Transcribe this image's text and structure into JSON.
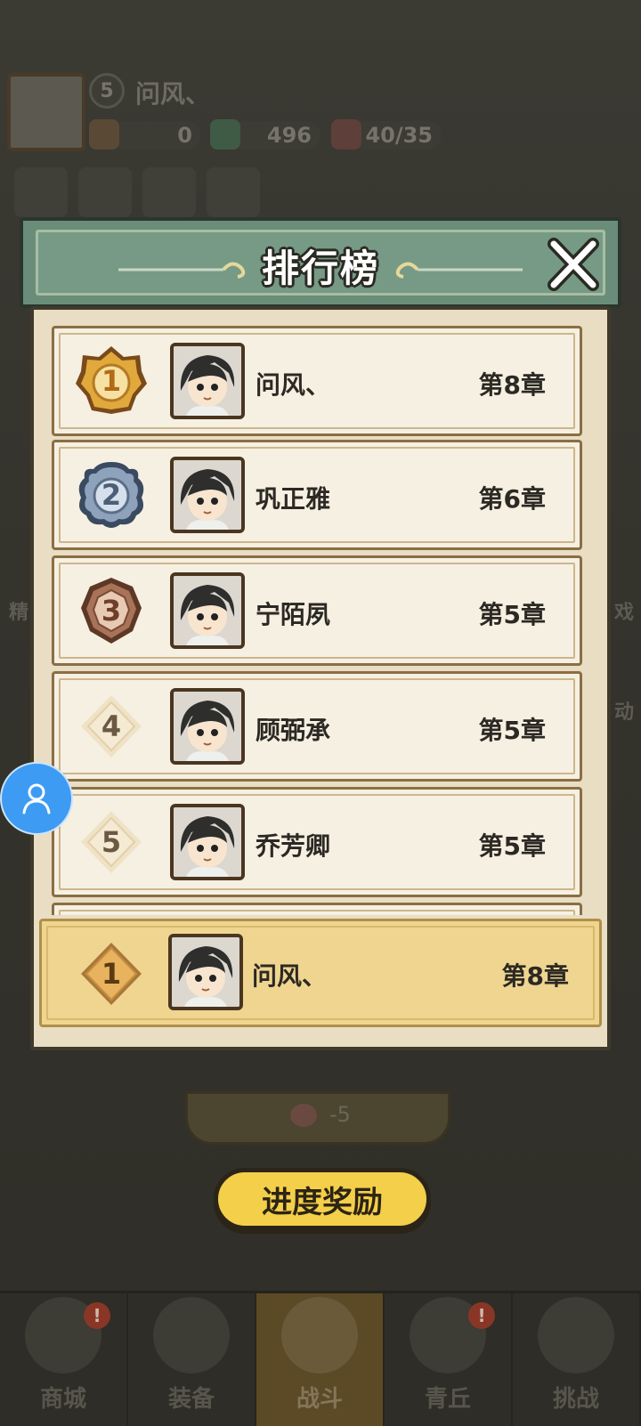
{
  "hud": {
    "level": "5",
    "player_name": "问风、",
    "resources": [
      {
        "icon": "coin-bag-icon",
        "value": "0"
      },
      {
        "icon": "jade-dragon-icon",
        "value": "496"
      },
      {
        "icon": "peach-energy-icon",
        "value": "40/35"
      }
    ]
  },
  "side_labels": {
    "left": "精",
    "right_top": "戏",
    "right_bottom": "动"
  },
  "progress": {
    "cost": "-5"
  },
  "progress_reward_label": "进度奖励",
  "leaderboard": {
    "title": "排行榜",
    "rows": [
      {
        "rank": "1",
        "name": "问风、",
        "chapter": "第8章"
      },
      {
        "rank": "2",
        "name": "巩正雅",
        "chapter": "第6章"
      },
      {
        "rank": "3",
        "name": "宁陌夙",
        "chapter": "第5章"
      },
      {
        "rank": "4",
        "name": "顾弼承",
        "chapter": "第5章"
      },
      {
        "rank": "5",
        "name": "乔芳卿",
        "chapter": "第5章"
      }
    ],
    "my_entry": {
      "rank": "1",
      "name": "问风、",
      "chapter": "第8章"
    }
  },
  "bottom_nav": [
    {
      "label": "商城",
      "badge": "!",
      "active": false
    },
    {
      "label": "装备",
      "badge": "",
      "active": false
    },
    {
      "label": "战斗",
      "badge": "",
      "active": true
    },
    {
      "label": "青丘",
      "badge": "!",
      "active": false
    },
    {
      "label": "挑战",
      "badge": "",
      "active": false
    }
  ],
  "colors": {
    "gold": "#d9a33a",
    "silver": "#7f94ae",
    "bronze": "#9d6a4f",
    "header_green": "#6a8d79",
    "reward_yellow": "#f4cf4a",
    "assist_blue": "#3d9bf3"
  }
}
